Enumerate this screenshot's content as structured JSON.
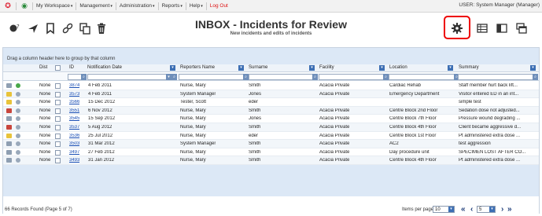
{
  "topnav": {
    "items": [
      "My Workspace",
      "Management",
      "Administration",
      "Reports",
      "Help"
    ],
    "logout": "Log Out",
    "user": "USER: System Manager (Manager)"
  },
  "header": {
    "title": "INBOX - Incidents for Review",
    "subtitle": "New incidents and edits of incidents"
  },
  "grid": {
    "group_hint": "Drag a column header here to group by that column",
    "columns": [
      "Dist",
      "ID",
      "Notification Date",
      "Reporters Name",
      "Surname",
      "Facility",
      "Location",
      "Summary"
    ],
    "rows": [
      {
        "dist": "None",
        "id": "3874",
        "date": "4 Feb 2011",
        "reporter": "Nurse, Mary",
        "surname": "Smith",
        "facility": "Acacia Private",
        "location": "Cardiac Rehab",
        "summary": "Staff member hurt back lift..."
      },
      {
        "dist": "None",
        "id": "3573",
        "date": "4 Feb 2011",
        "reporter": "System Manager",
        "surname": "Jones",
        "facility": "Acacia Private",
        "location": "Emergency Department",
        "summary": "Visitor entered ED in an int..."
      },
      {
        "dist": "None",
        "id": "3566",
        "date": "15 Dec 2012",
        "reporter": "Tester, Scott",
        "surname": "eder",
        "facility": "",
        "location": "",
        "summary": "simple test"
      },
      {
        "dist": "None",
        "id": "3551",
        "date": "6 Nov 2012",
        "reporter": "Nurse, Mary",
        "surname": "Smith",
        "facility": "Acacia Private",
        "location": "Centre Block 2nd Floor",
        "summary": "Sedation dose not adjusted..."
      },
      {
        "dist": "None",
        "id": "3545",
        "date": "15 Sep 2012",
        "reporter": "Nurse, Mary",
        "surname": "Jones",
        "facility": "Acacia Private",
        "location": "Centre Block 7th Floor",
        "summary": "Pressure wound degrading ..."
      },
      {
        "dist": "None",
        "id": "3537",
        "date": "5 Aug 2012",
        "reporter": "Nurse, Mary",
        "surname": "Smith",
        "facility": "Acacia Private",
        "location": "Centre Block 4th Floor",
        "summary": "Client became aggressive d..."
      },
      {
        "dist": "None",
        "id": "3536",
        "date": "25 Jul 2012",
        "reporter": "Nurse, Mary",
        "surname": "eder",
        "facility": "Acacia Private",
        "location": "Centre Block 1st Floor",
        "summary": "Pt administered extra dose ..."
      },
      {
        "dist": "None",
        "id": "3503",
        "date": "31 Mar 2012",
        "reporter": "System Manager",
        "surname": "Smith",
        "facility": "Acacia Private",
        "location": "AC2",
        "summary": "test aggression"
      },
      {
        "dist": "None",
        "id": "3497",
        "date": "27 Feb 2012",
        "reporter": "Nurse, Mary",
        "surname": "Smith",
        "facility": "Acacia Private",
        "location": "Day procedure unit",
        "summary": "SPECIMEN LOST AFTER CO..."
      },
      {
        "dist": "None",
        "id": "3493",
        "date": "31 Jan 2012",
        "reporter": "Nurse, Mary",
        "surname": "Smith",
        "facility": "Acacia Private",
        "location": "Centre Block 4th Floor",
        "summary": "Pt administered extra dose ..."
      }
    ]
  },
  "footer": {
    "records": "66 Records Found (Page 5 of 7)",
    "items_per_page_label": "Items per page:",
    "items_per_page_value": "10",
    "page_value": "5"
  },
  "colors": {
    "highlight": "#e00000",
    "link": "#1a4fb5",
    "header_bg": "#dce8f6",
    "logout": "#d11111"
  },
  "icons": [
    "star-icon",
    "refresh-icon",
    "hint-icon",
    "send-icon",
    "bookmark-icon",
    "link-icon",
    "copy-icon",
    "trash-icon",
    "gear-icon",
    "grid-view-icon",
    "columns-icon",
    "windows-icon"
  ]
}
